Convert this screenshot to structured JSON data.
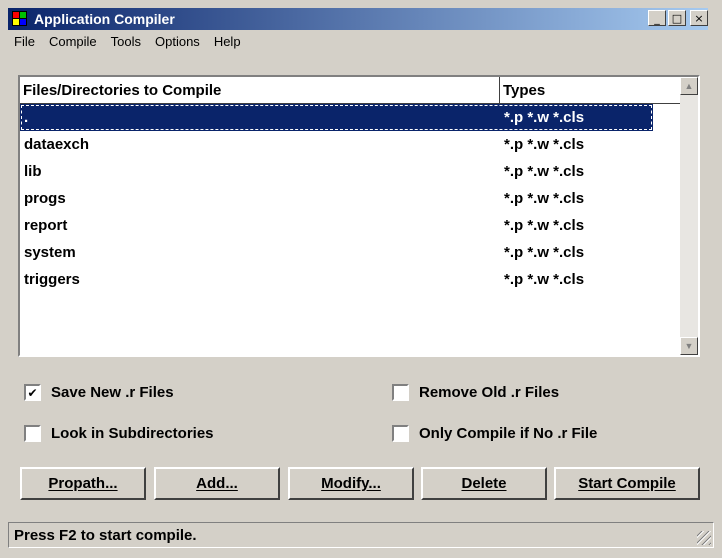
{
  "window": {
    "title": "Application Compiler",
    "controls": {
      "minimize": "_",
      "maximize": "□",
      "close": "×"
    }
  },
  "menu": [
    "File",
    "Compile",
    "Tools",
    "Options",
    "Help"
  ],
  "list": {
    "headers": {
      "name": "Files/Directories to Compile",
      "types": "Types"
    },
    "rows": [
      {
        "name": ".",
        "types": "*.p *.w *.cls",
        "selected": true
      },
      {
        "name": "dataexch",
        "types": "*.p *.w *.cls"
      },
      {
        "name": "lib",
        "types": "*.p *.w *.cls"
      },
      {
        "name": "progs",
        "types": "*.p *.w *.cls"
      },
      {
        "name": "report",
        "types": "*.p *.w *.cls"
      },
      {
        "name": "system",
        "types": "*.p *.w *.cls"
      },
      {
        "name": "triggers",
        "types": "*.p *.w *.cls"
      }
    ],
    "scroll_up_icon": "▲",
    "scroll_down_icon": "▼"
  },
  "options": {
    "save_new_r": {
      "label": "Save New .r Files",
      "checked": true
    },
    "remove_old_r": {
      "label": "Remove Old .r Files",
      "checked": false
    },
    "look_in_subdirs": {
      "label": "Look in Subdirectories",
      "checked": false
    },
    "only_compile_if_no_r": {
      "label": "Only Compile if No .r File",
      "checked": false
    }
  },
  "buttons": {
    "propath": "Propath...",
    "add": "Add...",
    "modify": "Modify...",
    "delete": "Delete",
    "start_compile": "Start Compile"
  },
  "status": "Press F2 to start compile.",
  "colors": {
    "titlebar_start": "#0a246a",
    "titlebar_end": "#a6caf0",
    "selection": "#0a246a",
    "face": "#d4d0c8"
  }
}
